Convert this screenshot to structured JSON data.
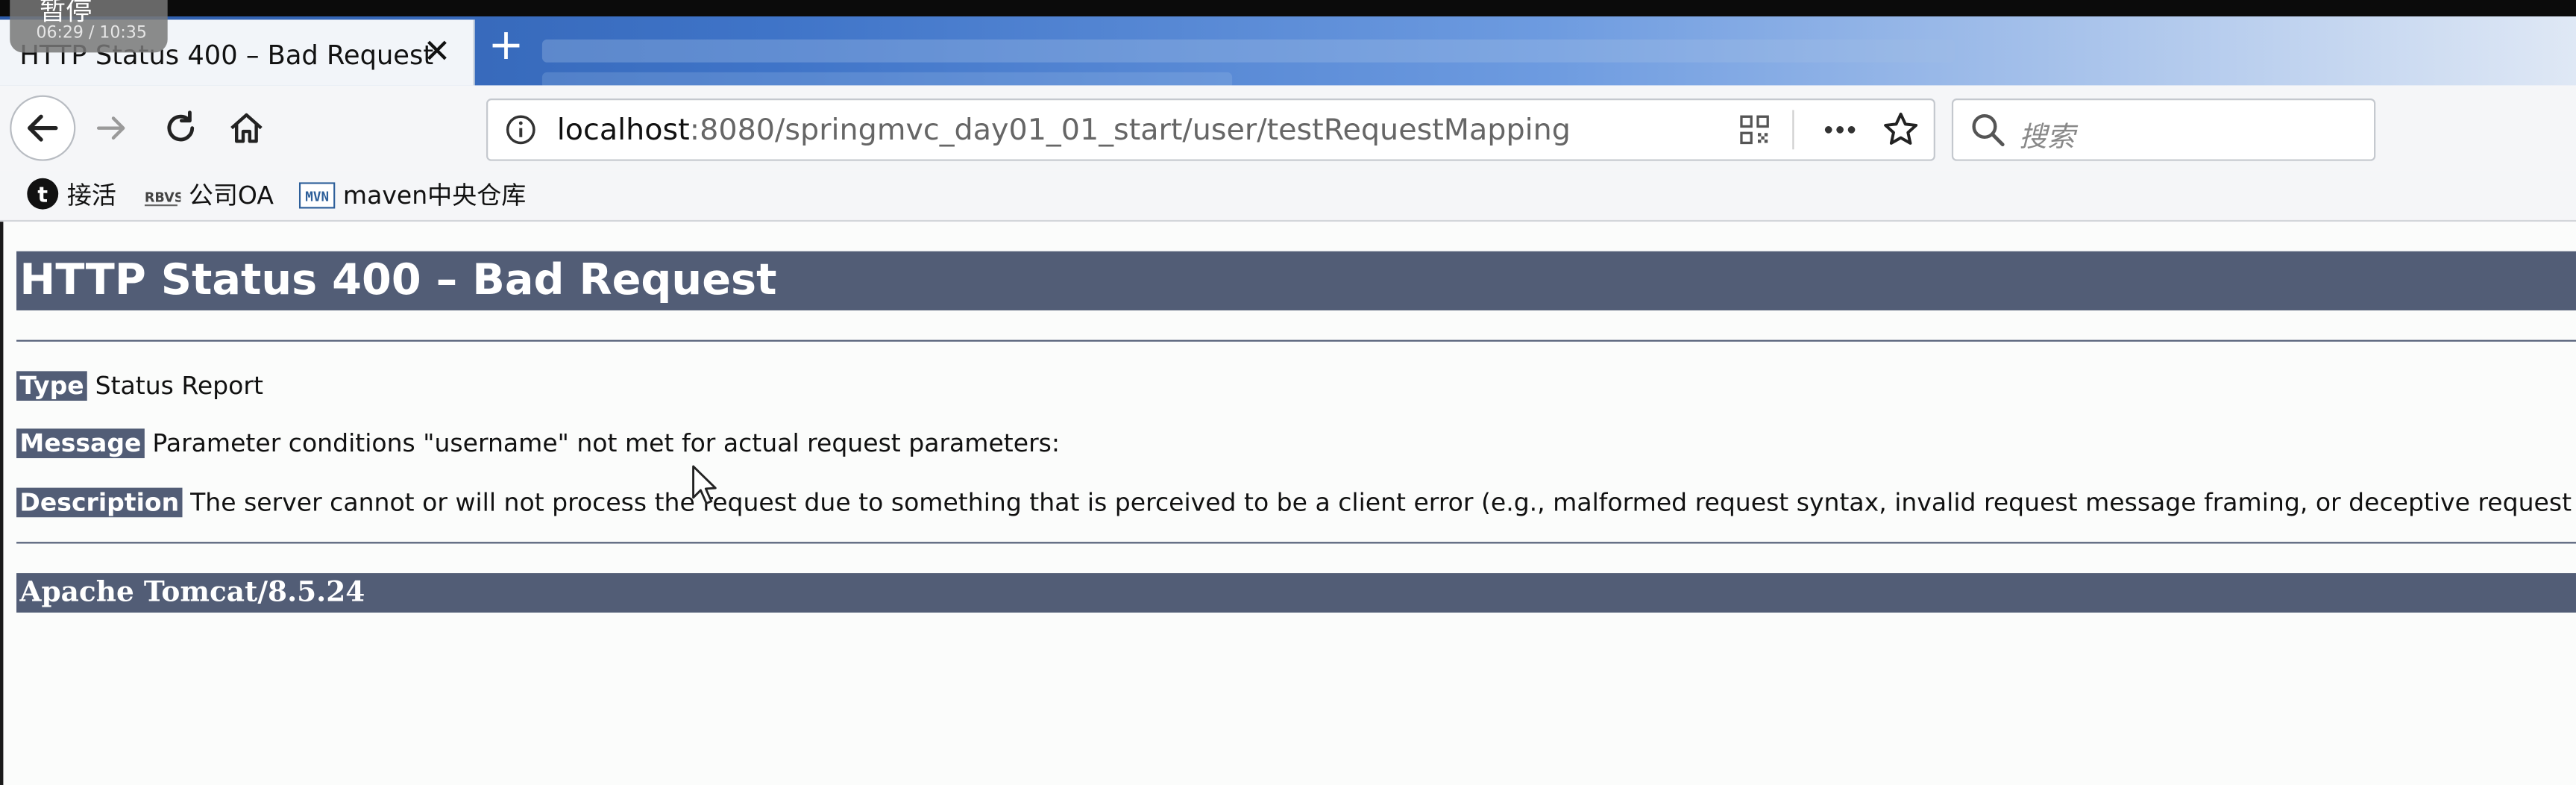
{
  "overlay": {
    "pause_label": "暂停",
    "time": "06:29 / 10:35"
  },
  "browser": {
    "active_tab_title": "HTTP Status 400 – Bad Request",
    "close_glyph": "✕",
    "new_tab_glyph": "+",
    "url_host": "localhost",
    "url_rest": ":8080/springmvc_day01_01_start/user/testRequestMapping",
    "search_placeholder": "搜索",
    "bookmarks": [
      {
        "label": "接活",
        "icon": "circle-t-icon"
      },
      {
        "label": "公司OA",
        "icon": "rbvs-icon"
      },
      {
        "label": "maven中央仓库",
        "icon": "mvn-icon"
      }
    ]
  },
  "page": {
    "title": "HTTP Status 400 – Bad Request",
    "type_label": "Type",
    "type_value": "Status Report",
    "message_label": "Message",
    "message_value": "Parameter conditions \"username\" not met for actual request parameters:",
    "description_label": "Description",
    "description_value": "The server cannot or will not process the request due to something that is perceived to be a client error (e.g., malformed request syntax, invalid request message framing, or deceptive request routing).",
    "footer": "Apache Tomcat/8.5.24"
  },
  "colors": {
    "tomcat_header": "#525d76",
    "page_bg": "#fbfcfb",
    "toolbar_bg": "#f5f6f8"
  }
}
